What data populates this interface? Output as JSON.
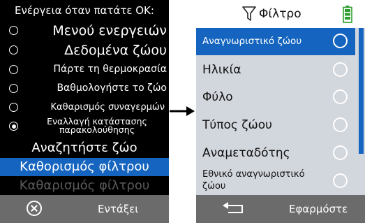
{
  "left_screen": {
    "header": "Ενέργεια όταν πατάτε ΟΚ:",
    "options": [
      {
        "label": "Μενού ενεργειών",
        "checked": false
      },
      {
        "label": "Δεδομένα ζώου",
        "checked": false
      },
      {
        "label": "Πάρτε τη θερμοκρασία",
        "checked": false
      },
      {
        "label": "Βαθμολογήστε το ζώο",
        "checked": false
      },
      {
        "label": "Καθαρισμός συναγερμών",
        "checked": false
      },
      {
        "label_line1": "Εναλλαγή κατάστασης",
        "label_line2": "παρακολούθησης",
        "checked": true
      }
    ],
    "context_menu": {
      "search": "Αναζητήστε ζώο",
      "define_filter": "Καθορισμός φίλτρου",
      "clear_filter": "Καθαρισμός φίλτρου"
    },
    "footer": {
      "close_icon": "close-circle-icon",
      "enter_label": "Εντάξει"
    }
  },
  "right_screen": {
    "title": "Φίλτρο",
    "filter_icon": "funnel-icon",
    "battery_icon": "battery-icon",
    "items": [
      {
        "label": "Αναγνωριστικό ζώου",
        "selected": true
      },
      {
        "label": "Ηλικία",
        "selected": false
      },
      {
        "label": "Φύλο",
        "selected": false
      },
      {
        "label": "Τύπος ζώου",
        "selected": false
      },
      {
        "label": "Αναμεταδότης",
        "selected": false
      },
      {
        "label_line1": "Εθνικό αναγνωριστικό",
        "label_line2": "ζώου",
        "selected": false
      }
    ],
    "footer": {
      "back_icon": "back-arrow-icon",
      "apply_label": "Εφαρμόστε"
    }
  },
  "colors": {
    "accent": "#1565c0",
    "footer_gray": "#6b6b6b",
    "list_bg": "#d2d6dd",
    "battery_green": "#2e9e2e"
  }
}
